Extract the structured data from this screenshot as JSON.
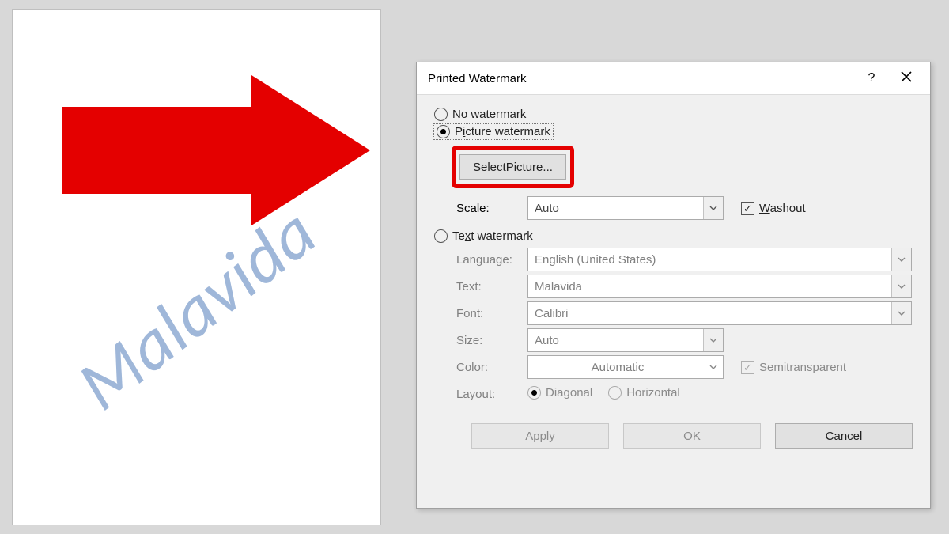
{
  "doc": {
    "watermark_text": "Malavida"
  },
  "dialog": {
    "title": "Printed Watermark",
    "help": "?",
    "radio_no_label_pre": "",
    "radio_no_u": "N",
    "radio_no_label_post": "o watermark",
    "radio_pic_label_pre": "P",
    "radio_pic_u": "i",
    "radio_pic_label_post": "cture watermark",
    "radio_text_label_pre": "Te",
    "radio_text_u": "x",
    "radio_text_label_post": "t watermark",
    "select_picture_pre": "Select ",
    "select_picture_u": "P",
    "select_picture_post": "icture...",
    "scale_label": "Scale:",
    "scale_value": "Auto",
    "washout_u": "W",
    "washout_post": "ashout",
    "language_label": "Language:",
    "language_value": "English (United States)",
    "text_label": "Text:",
    "text_value": "Malavida",
    "font_label": "Font:",
    "font_value": "Calibri",
    "size_label": "Size:",
    "size_value": "Auto",
    "color_label": "Color:",
    "color_value": "Automatic",
    "semitrans_label": "Semitransparent",
    "layout_label": "Layout:",
    "layout_opt1": "Diagonal",
    "layout_opt2": "Horizontal",
    "btn_apply": "Apply",
    "btn_ok": "OK",
    "btn_cancel": "Cancel"
  }
}
